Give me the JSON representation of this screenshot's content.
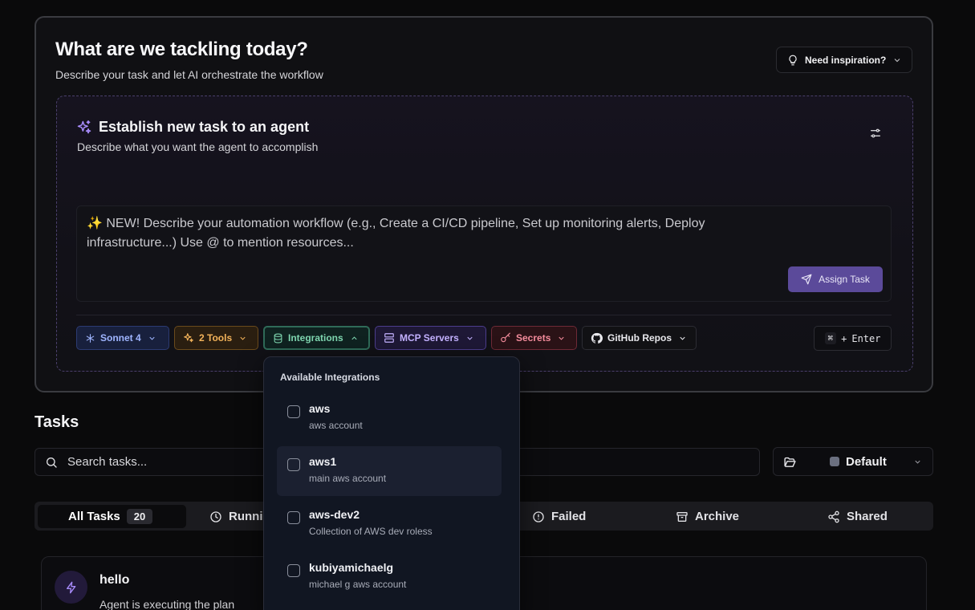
{
  "hero": {
    "title": "What are we tackling today?",
    "subtitle": "Describe your task and let AI orchestrate the workflow",
    "inspiration_label": "Need inspiration?"
  },
  "composer": {
    "title": "Establish new task to an agent",
    "subtitle": "Describe what you want the agent to accomplish",
    "prompt_placeholder": "✨ NEW! Describe your automation workflow (e.g., Create a CI/CD pipeline, Set up monitoring alerts, Deploy infrastructure...) Use @ to mention resources...",
    "assign_label": "Assign Task",
    "chips": {
      "model": "Sonnet 4",
      "tools": "2 Tools",
      "integrations": "Integrations",
      "mcp": "MCP Servers",
      "secrets": "Secrets",
      "github": "GitHub Repos"
    },
    "shortcut": {
      "key1": "⌘",
      "plus": "+",
      "key2": "Enter"
    }
  },
  "integrations_dropdown": {
    "heading": "Available Integrations",
    "items": [
      {
        "name": "aws",
        "desc": "aws account"
      },
      {
        "name": "aws1",
        "desc": "main aws account"
      },
      {
        "name": "aws-dev2",
        "desc": "Collection of AWS dev roless"
      },
      {
        "name": "kubiyamichaelg",
        "desc": "michael g aws account"
      }
    ]
  },
  "tasks": {
    "heading": "Tasks",
    "search_placeholder": "Search tasks...",
    "folder": "Default",
    "tabs": {
      "all": "All Tasks",
      "all_count": "20",
      "running": "Running",
      "failed": "Failed",
      "archive": "Archive",
      "shared": "Shared"
    },
    "first_task": {
      "title": "hello",
      "status": "Agent is executing the plan"
    }
  }
}
